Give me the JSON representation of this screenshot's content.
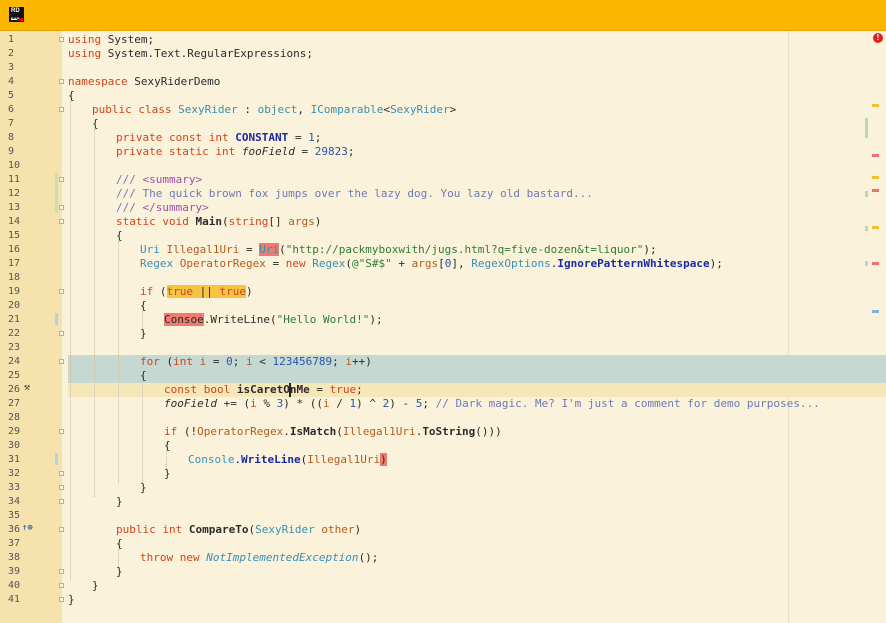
{
  "app": {
    "logo_text_1": "RD",
    "logo_text_2": "EAP"
  },
  "error_indicator": {
    "icon": "error-icon",
    "label": "!"
  },
  "gutter": {
    "line_numbers": [
      "1",
      "2",
      "3",
      "4",
      "5",
      "6",
      "7",
      "8",
      "9",
      "10",
      "11",
      "12",
      "13",
      "14",
      "15",
      "16",
      "17",
      "18",
      "19",
      "20",
      "21",
      "22",
      "23",
      "24",
      "25",
      "26",
      "27",
      "28",
      "29",
      "30",
      "31",
      "32",
      "33",
      "34",
      "35",
      "36",
      "37",
      "38",
      "39",
      "40",
      "41"
    ],
    "line26_icon": "hammer-icon",
    "line26_glyph": "⚒",
    "line36_icon": "implements-icon",
    "line36_glyph": "↑⊕"
  },
  "code": {
    "l1": [
      "using",
      " System;"
    ],
    "l2": [
      "using",
      " System.Text.RegularExpressions;"
    ],
    "l4": [
      "namespace",
      " SexyRiderDemo"
    ],
    "l5": "{",
    "l6": [
      "public class ",
      "SexyRider",
      " : ",
      "object",
      ", ",
      "IComparable",
      "<",
      "SexyRider",
      ">"
    ],
    "l7": "{",
    "l8": [
      "private const ",
      "int",
      " ",
      "CONSTANT",
      " = ",
      "1",
      ";"
    ],
    "l9": [
      "private static ",
      "int",
      " ",
      "fooField",
      " = ",
      "29823",
      ";"
    ],
    "l11": [
      "/// ",
      "<summary>"
    ],
    "l12": "/// The quick brown fox jumps over the lazy dog. You lazy old bastard...",
    "l13": [
      "/// ",
      "</summary>"
    ],
    "l14": [
      "static void ",
      "Main",
      "(",
      "string",
      "[] ",
      "args",
      ")"
    ],
    "l15": "{",
    "l16": [
      "Uri",
      " ",
      "Illegal1Uri",
      " = ",
      "Uri",
      "(",
      "\"http://packmyboxwith/jugs.html?q=five-dozen&t=liquor\"",
      ");"
    ],
    "l17": [
      "Regex",
      " ",
      "OperatorRegex",
      " = ",
      "new ",
      "Regex",
      "(",
      "@\"S#$\"",
      " + ",
      "args",
      "[",
      "0",
      "], ",
      "RegexOptions",
      ".",
      "IgnorePatternWhitespace",
      ");"
    ],
    "l19": [
      "if",
      " (",
      "true",
      " || ",
      "true",
      ")"
    ],
    "l20": "{",
    "l21": [
      "Consoe",
      ".WriteLine(",
      "\"Hello World!\"",
      ");"
    ],
    "l22": "}",
    "l24": [
      "for",
      " (",
      "int",
      " ",
      "i",
      " = ",
      "0",
      "; ",
      "i",
      " < ",
      "123456789",
      "; ",
      "i",
      "++)"
    ],
    "l25": "{",
    "l26": [
      "const bool ",
      "isCaretOnMe",
      " = ",
      "true",
      ";"
    ],
    "l27": [
      "fooField",
      " += (",
      "i",
      " % ",
      "3",
      ") * ((",
      "i",
      " / ",
      "1",
      ") ^ ",
      "2",
      ") - ",
      "5",
      "; ",
      "// Dark magic. Me? I'm just a comment for demo purposes..."
    ],
    "l29": [
      "if",
      " (!",
      "OperatorRegex",
      ".",
      "IsMatch",
      "(",
      "Illegal1Uri",
      ".",
      "ToString",
      "()))"
    ],
    "l30": "{",
    "l31": [
      "Console",
      ".",
      "WriteLine",
      "(",
      "Illegal1Uri",
      ")"
    ],
    "l32": "}",
    "l33": "}",
    "l34": "}",
    "l36": [
      "public ",
      "int",
      " ",
      "CompareTo",
      "(",
      "SexyRider",
      " ",
      "other",
      ")"
    ],
    "l37": "{",
    "l38": [
      "throw new ",
      "NotImplementedException",
      "();"
    ],
    "l39": "}",
    "l40": "}",
    "l41": "}"
  },
  "colors": {
    "titlebar": "#fbb600",
    "gutter": "#f6e2ac",
    "editor_bg": "#fbf2dc",
    "keyword": "#d2431b",
    "type": "#3a8fb0",
    "string": "#2e7d32",
    "number": "#2857a6",
    "comment": "#6d79b8",
    "error_highlight": "#ef7a70",
    "warning_highlight": "#f5c445",
    "selection": "#c5d8d2"
  }
}
